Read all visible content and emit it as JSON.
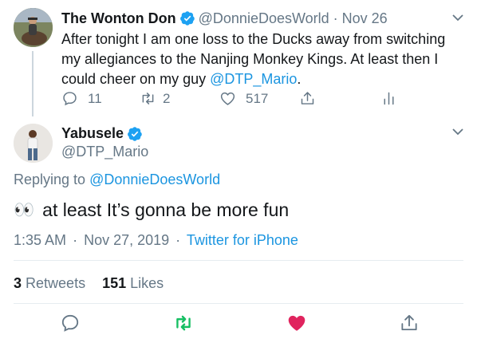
{
  "parent": {
    "display_name": "The Wonton Don",
    "handle": "@DonnieDoesWorld",
    "separator": "·",
    "date": "Nov 26",
    "text_before_mention": "After tonight I am one loss to the Ducks away from switching my allegiances to the Nanjing Monkey Kings. At least then I could cheer on my guy ",
    "mention": "@DTP_Mario",
    "text_after_mention": ".",
    "replies_count": "11",
    "retweets_count": "2",
    "likes_count": "517"
  },
  "main": {
    "display_name": "Yabusele",
    "handle": "@DTP_Mario",
    "replying_prefix": "Replying to ",
    "replying_handle": "@DonnieDoesWorld",
    "emoji": "👀",
    "text": "at least It’s gonna be more fun",
    "time": "1:35 AM",
    "separator": "·",
    "date": "Nov 27, 2019",
    "source": "Twitter for iPhone",
    "retweets_count": "3",
    "retweets_label": "Retweets",
    "likes_count": "151",
    "likes_label": "Likes"
  },
  "colors": {
    "link": "#1b95e0",
    "secondary_text": "#657786",
    "retweet_active": "#17bf63",
    "like_active": "#e0245e",
    "verified": "#1da1f2"
  }
}
